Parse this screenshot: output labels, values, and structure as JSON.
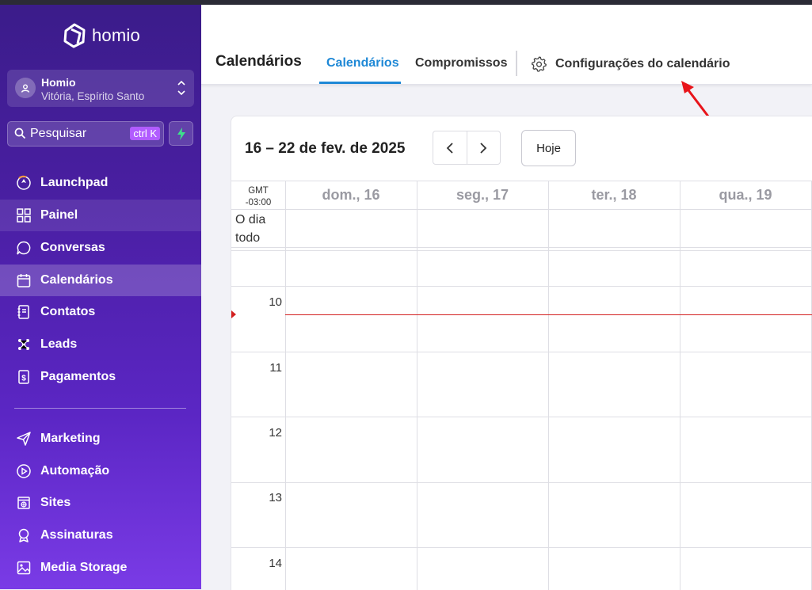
{
  "app": {
    "brand": "homio"
  },
  "account": {
    "name": "Homio",
    "location": "Vitória, Espírito Santo"
  },
  "search": {
    "label": "Pesquisar",
    "shortcut": "ctrl K"
  },
  "sidebar": {
    "items": [
      {
        "label": "Launchpad",
        "icon": "rocket-icon"
      },
      {
        "label": "Painel",
        "icon": "dashboard-icon"
      },
      {
        "label": "Conversas",
        "icon": "chat-icon"
      },
      {
        "label": "Calendários",
        "icon": "calendar-icon"
      },
      {
        "label": "Contatos",
        "icon": "contacts-icon"
      },
      {
        "label": "Leads",
        "icon": "leads-icon"
      },
      {
        "label": "Pagamentos",
        "icon": "payments-icon"
      },
      {
        "label": "Marketing",
        "icon": "send-icon"
      },
      {
        "label": "Automação",
        "icon": "automation-icon"
      },
      {
        "label": "Sites",
        "icon": "sites-icon"
      },
      {
        "label": "Assinaturas",
        "icon": "badge-icon"
      },
      {
        "label": "Media Storage",
        "icon": "image-icon"
      }
    ],
    "active": "Calendários",
    "hover": "Painel"
  },
  "header": {
    "title": "Calendários",
    "tabs": [
      {
        "label": "Calendários",
        "active": true
      },
      {
        "label": "Compromissos",
        "active": false
      }
    ],
    "settings_label": "Configurações do calendário"
  },
  "calendar": {
    "range": "16 – 22 de fev. de 2025",
    "today_label": "Hoje",
    "timezone": {
      "line1": "GMT",
      "line2": "-03:00"
    },
    "all_day": {
      "line1": "O dia",
      "line2": "todo"
    },
    "days": [
      "dom., 16",
      "seg., 17",
      "ter., 18",
      "qua., 19"
    ],
    "hours": [
      "10",
      "11",
      "12",
      "13",
      "14"
    ]
  },
  "colors": {
    "accent": "#1e88d6",
    "now_line": "#d32020",
    "sidebar_top": "#3b1c8a",
    "sidebar_bottom": "#7a3be6"
  }
}
